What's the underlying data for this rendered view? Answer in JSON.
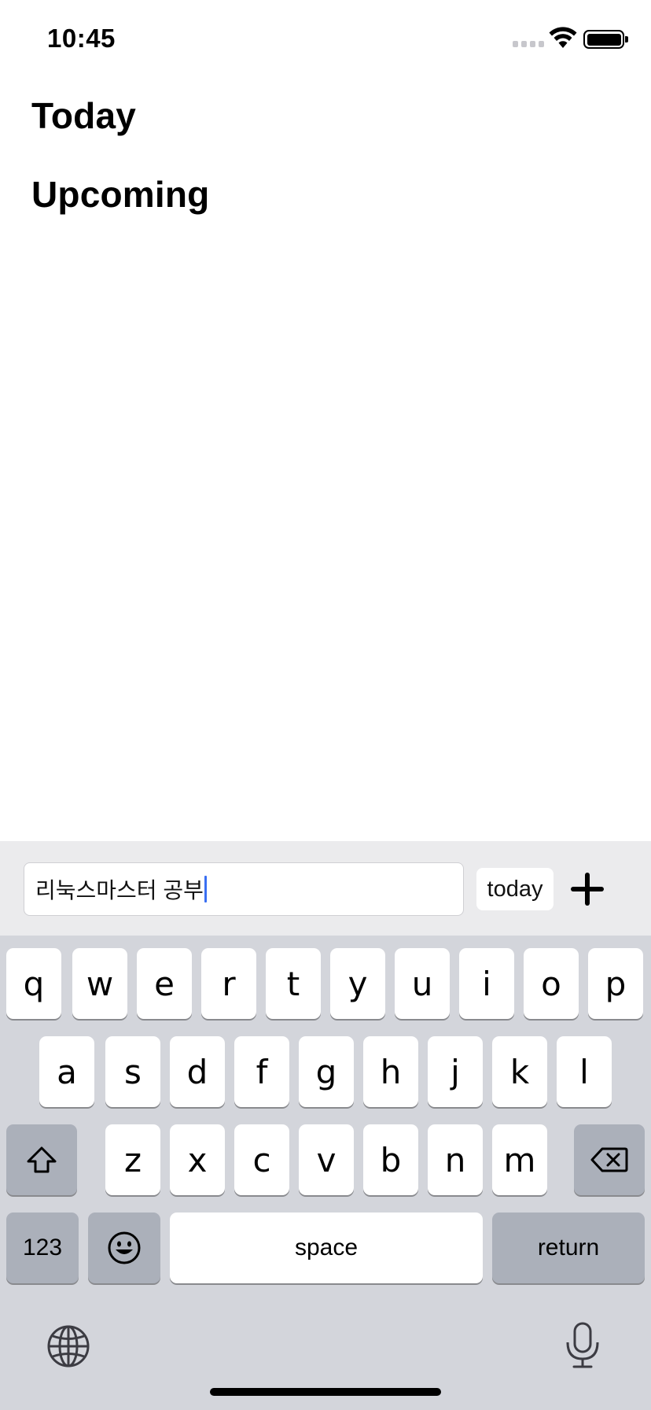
{
  "status_bar": {
    "time": "10:45",
    "icons": [
      "cellular-signal-icon",
      "wifi-icon",
      "battery-icon"
    ]
  },
  "sections": {
    "today_title": "Today",
    "upcoming_title": "Upcoming"
  },
  "input_bar": {
    "task_value": "리눅스마스터 공부",
    "date_label": "today",
    "add_icon": "plus-icon"
  },
  "keyboard": {
    "row1": [
      "q",
      "w",
      "e",
      "r",
      "t",
      "y",
      "u",
      "i",
      "o",
      "p"
    ],
    "row2": [
      "a",
      "s",
      "d",
      "f",
      "g",
      "h",
      "j",
      "k",
      "l"
    ],
    "row3": [
      "z",
      "x",
      "c",
      "v",
      "b",
      "n",
      "m"
    ],
    "numbers_label": "123",
    "space_label": "space",
    "return_label": "return",
    "icons": [
      "shift-icon",
      "backspace-icon",
      "emoji-icon",
      "globe-icon",
      "microphone-icon"
    ]
  },
  "colors": {
    "caret": "#3a6ff2",
    "keyboard_bg": "#d3d5db",
    "input_bar_bg": "#ebebed"
  }
}
